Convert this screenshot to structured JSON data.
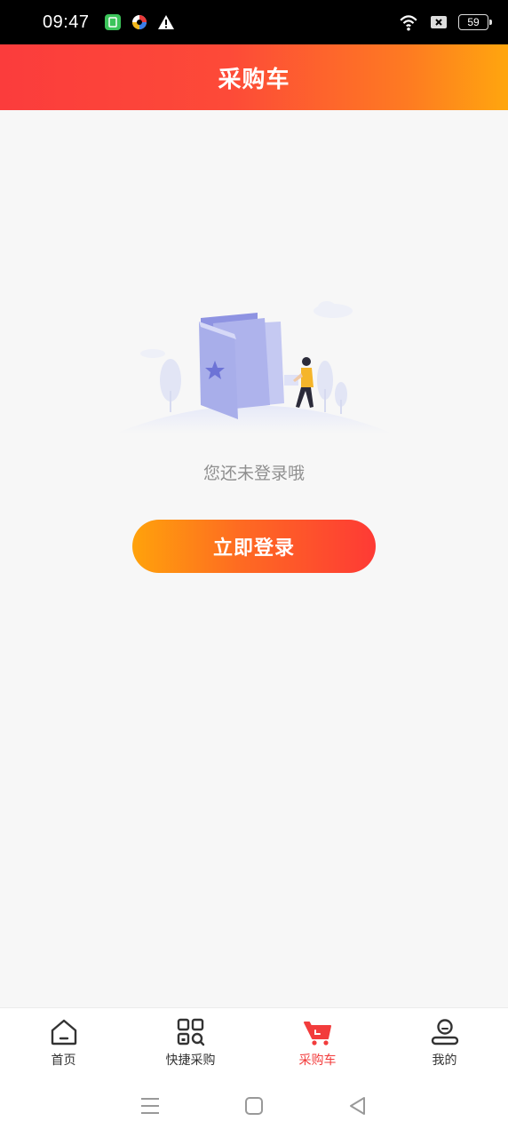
{
  "status_bar": {
    "time": "09:47",
    "battery": "59"
  },
  "header": {
    "title": "采购车"
  },
  "empty_state": {
    "message": "您还未登录哦",
    "login_button": "立即登录"
  },
  "tabs": [
    {
      "label": "首页",
      "icon": "home-icon",
      "active": false
    },
    {
      "label": "快捷采购",
      "icon": "qr-scan-icon",
      "active": false
    },
    {
      "label": "采购车",
      "icon": "cart-icon",
      "active": true
    },
    {
      "label": "我的",
      "icon": "user-icon",
      "active": false
    }
  ],
  "colors": {
    "accent": "#f23c3c",
    "header_gradient_start": "#fb3c3c",
    "header_gradient_end": "#ffa60e"
  }
}
